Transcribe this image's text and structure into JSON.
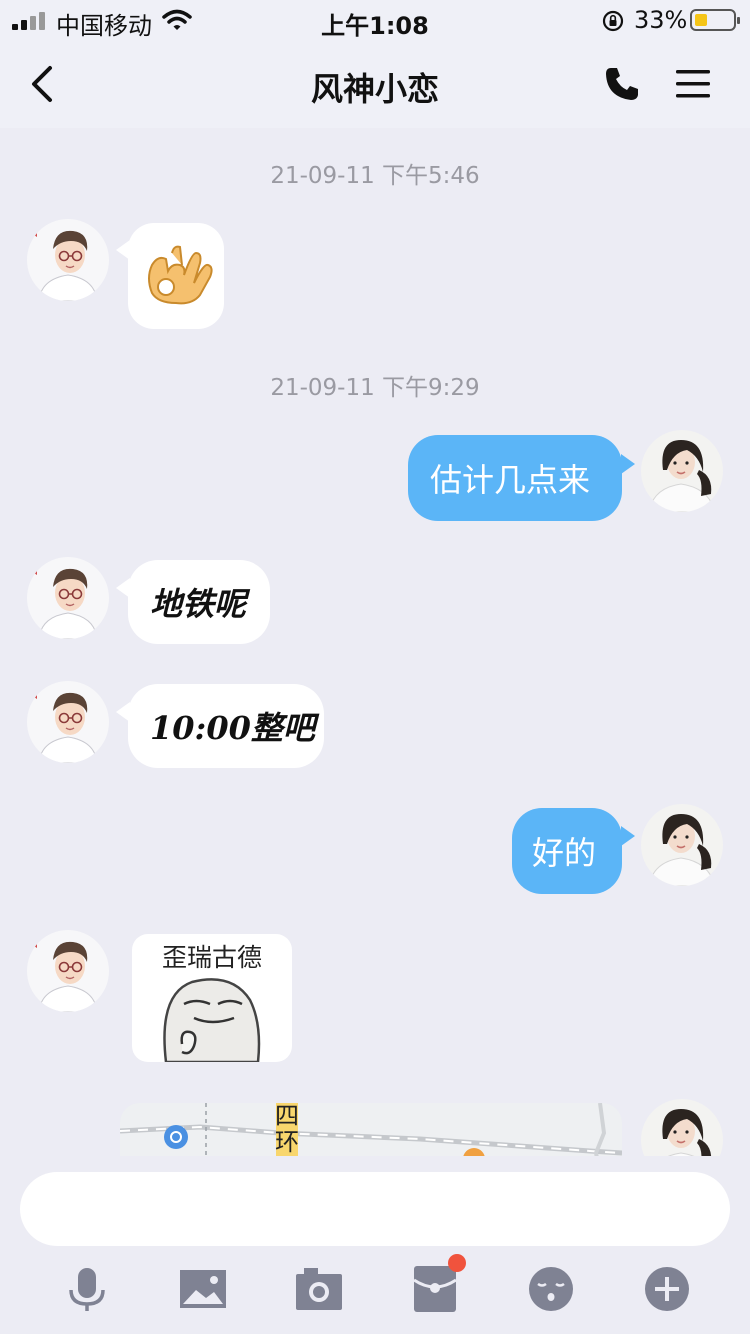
{
  "status_bar": {
    "carrier": "中国移动",
    "time": "上午1:08",
    "battery_percent": "33%",
    "battery_level": 0.33
  },
  "nav": {
    "title": "风神小恋",
    "icons": [
      "back-icon",
      "phone-icon",
      "menu-icon"
    ]
  },
  "messages": [
    {
      "type": "timestamp",
      "text": "21-09-11 下午5:46"
    },
    {
      "type": "sticker",
      "side": "left",
      "content": "ok-hand-emoji"
    },
    {
      "type": "timestamp",
      "text": "21-09-11 下午9:29"
    },
    {
      "type": "text",
      "side": "right",
      "text": "估计几点来"
    },
    {
      "type": "text",
      "side": "left",
      "text": "地铁呢"
    },
    {
      "type": "text",
      "side": "left",
      "text": "10:00整吧"
    },
    {
      "type": "text",
      "side": "right",
      "text": "好的"
    },
    {
      "type": "sticker",
      "side": "left",
      "caption": "歪瑞古德"
    },
    {
      "type": "location",
      "side": "right",
      "map_label": "四环"
    }
  ],
  "input": {
    "placeholder": "",
    "toolbar": [
      "microphone-icon",
      "image-icon",
      "camera-icon",
      "red-packet-icon",
      "emoji-icon",
      "plus-icon"
    ]
  },
  "colors": {
    "sent_bubble": "#5bb5f7",
    "received_bubble": "#ffffff",
    "background": "#ececf4",
    "badge": "#f0533d"
  }
}
